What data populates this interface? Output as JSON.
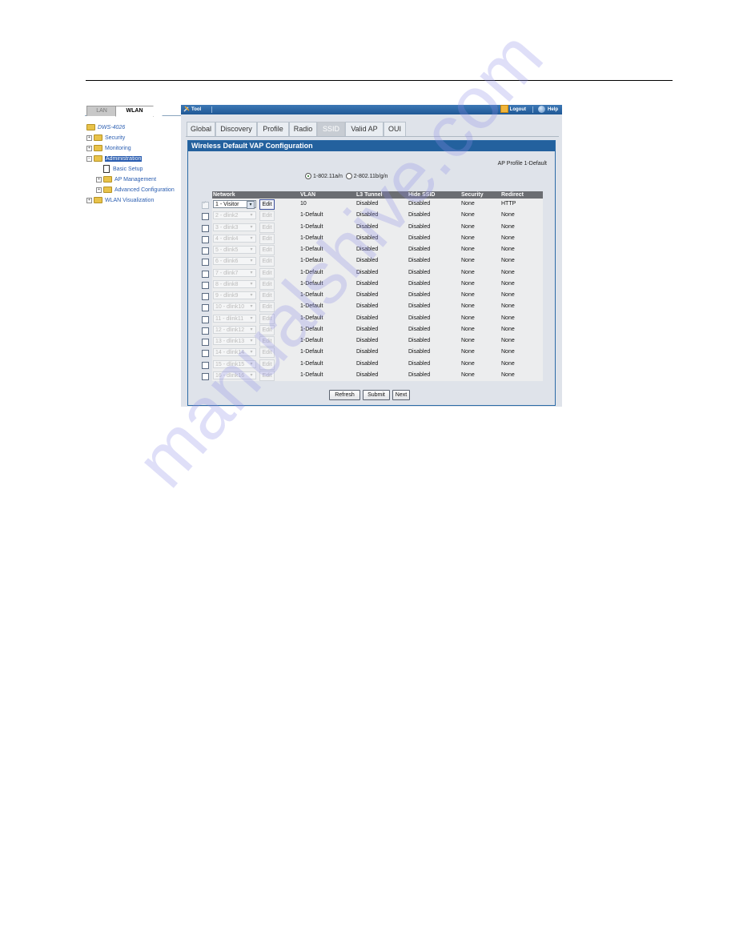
{
  "leftnav": {
    "tabs": [
      {
        "label": "LAN",
        "active": false
      },
      {
        "label": "WLAN",
        "active": true
      }
    ],
    "tree": [
      {
        "label": "DWS-4026",
        "icon": "folder-open-icon",
        "level": 0,
        "expander": ""
      },
      {
        "label": "Security",
        "icon": "folder-icon",
        "level": 1,
        "expander": "+"
      },
      {
        "label": "Monitoring",
        "icon": "folder-icon",
        "level": 1,
        "expander": "+"
      },
      {
        "label": "Administration",
        "icon": "folder-open-icon",
        "level": 1,
        "expander": "-",
        "selected": true
      },
      {
        "label": "Basic Setup",
        "icon": "document-icon",
        "level": 2,
        "expander": ""
      },
      {
        "label": "AP Management",
        "icon": "folder-icon",
        "level": 2,
        "expander": "+"
      },
      {
        "label": "Advanced Configuration",
        "icon": "folder-icon",
        "level": 2,
        "expander": "+"
      },
      {
        "label": "WLAN Visualization",
        "icon": "folder-icon",
        "level": 1,
        "expander": "+"
      }
    ]
  },
  "toolbar": {
    "tool_label": "Tool",
    "logout_label": "Logout",
    "help_label": "Help"
  },
  "tabs": [
    {
      "label": "Global",
      "active": false
    },
    {
      "label": "Discovery",
      "active": false
    },
    {
      "label": "Profile",
      "active": false
    },
    {
      "label": "Radio",
      "active": false
    },
    {
      "label": "SSID",
      "active": true
    },
    {
      "label": "Valid AP",
      "active": false
    },
    {
      "label": "OUI",
      "active": false
    }
  ],
  "panel": {
    "title": "Wireless Default VAP Configuration",
    "ap_profile": "AP Profile 1-Default",
    "radio_options": [
      {
        "label": "1-802.11a/n",
        "selected": true
      },
      {
        "label": "2-802.11b/g/n",
        "selected": false
      }
    ]
  },
  "table": {
    "columns": [
      "Network",
      "VLAN",
      "L3 Tunnel",
      "Hide SSID",
      "Security",
      "Redirect"
    ],
    "edit_label": "Edit",
    "rows": [
      {
        "checked": true,
        "enabled": true,
        "network": "1 - Visitor",
        "vlan": "10",
        "l3_tunnel": "Disabled",
        "hide_ssid": "Disabled",
        "security": "None",
        "redirect": "HTTP"
      },
      {
        "checked": false,
        "enabled": false,
        "network": "2 - dlink2",
        "vlan": "1-Default",
        "l3_tunnel": "Disabled",
        "hide_ssid": "Disabled",
        "security": "None",
        "redirect": "None"
      },
      {
        "checked": false,
        "enabled": false,
        "network": "3 - dlink3",
        "vlan": "1-Default",
        "l3_tunnel": "Disabled",
        "hide_ssid": "Disabled",
        "security": "None",
        "redirect": "None"
      },
      {
        "checked": false,
        "enabled": false,
        "network": "4 - dlink4",
        "vlan": "1-Default",
        "l3_tunnel": "Disabled",
        "hide_ssid": "Disabled",
        "security": "None",
        "redirect": "None"
      },
      {
        "checked": false,
        "enabled": false,
        "network": "5 - dlink5",
        "vlan": "1-Default",
        "l3_tunnel": "Disabled",
        "hide_ssid": "Disabled",
        "security": "None",
        "redirect": "None"
      },
      {
        "checked": false,
        "enabled": false,
        "network": "6 - dlink6",
        "vlan": "1-Default",
        "l3_tunnel": "Disabled",
        "hide_ssid": "Disabled",
        "security": "None",
        "redirect": "None"
      },
      {
        "checked": false,
        "enabled": false,
        "network": "7 - dlink7",
        "vlan": "1-Default",
        "l3_tunnel": "Disabled",
        "hide_ssid": "Disabled",
        "security": "None",
        "redirect": "None"
      },
      {
        "checked": false,
        "enabled": false,
        "network": "8 - dlink8",
        "vlan": "1-Default",
        "l3_tunnel": "Disabled",
        "hide_ssid": "Disabled",
        "security": "None",
        "redirect": "None"
      },
      {
        "checked": false,
        "enabled": false,
        "network": "9 - dlink9",
        "vlan": "1-Default",
        "l3_tunnel": "Disabled",
        "hide_ssid": "Disabled",
        "security": "None",
        "redirect": "None"
      },
      {
        "checked": false,
        "enabled": false,
        "network": "10 - dlink10",
        "vlan": "1-Default",
        "l3_tunnel": "Disabled",
        "hide_ssid": "Disabled",
        "security": "None",
        "redirect": "None"
      },
      {
        "checked": false,
        "enabled": false,
        "network": "11 - dlink11",
        "vlan": "1-Default",
        "l3_tunnel": "Disabled",
        "hide_ssid": "Disabled",
        "security": "None",
        "redirect": "None"
      },
      {
        "checked": false,
        "enabled": false,
        "network": "12 - dlink12",
        "vlan": "1-Default",
        "l3_tunnel": "Disabled",
        "hide_ssid": "Disabled",
        "security": "None",
        "redirect": "None"
      },
      {
        "checked": false,
        "enabled": false,
        "network": "13 - dlink13",
        "vlan": "1-Default",
        "l3_tunnel": "Disabled",
        "hide_ssid": "Disabled",
        "security": "None",
        "redirect": "None"
      },
      {
        "checked": false,
        "enabled": false,
        "network": "14 - dlink14",
        "vlan": "1-Default",
        "l3_tunnel": "Disabled",
        "hide_ssid": "Disabled",
        "security": "None",
        "redirect": "None"
      },
      {
        "checked": false,
        "enabled": false,
        "network": "15 - dlink15",
        "vlan": "1-Default",
        "l3_tunnel": "Disabled",
        "hide_ssid": "Disabled",
        "security": "None",
        "redirect": "None"
      },
      {
        "checked": false,
        "enabled": false,
        "network": "16 - dlink16",
        "vlan": "1-Default",
        "l3_tunnel": "Disabled",
        "hide_ssid": "Disabled",
        "security": "None",
        "redirect": "None"
      }
    ]
  },
  "buttons": {
    "refresh": "Refresh",
    "submit": "Submit",
    "next": "Next"
  },
  "watermark": "manualshive.com"
}
